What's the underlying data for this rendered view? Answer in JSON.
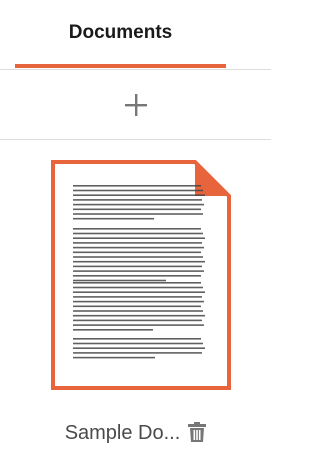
{
  "tabs": [
    {
      "label": "Documents",
      "active": true
    }
  ],
  "add_button": {
    "icon": "plus-icon"
  },
  "documents": [
    {
      "name": "Sample Do...",
      "thumbnail_icon": "document-page-icon",
      "delete_icon": "trash-icon"
    }
  ],
  "colors": {
    "accent": "#e8643c",
    "text_dark": "#1a1a1a",
    "text_muted": "#4a4a4a",
    "icon_gray": "#777777",
    "divider": "#dddddd"
  }
}
